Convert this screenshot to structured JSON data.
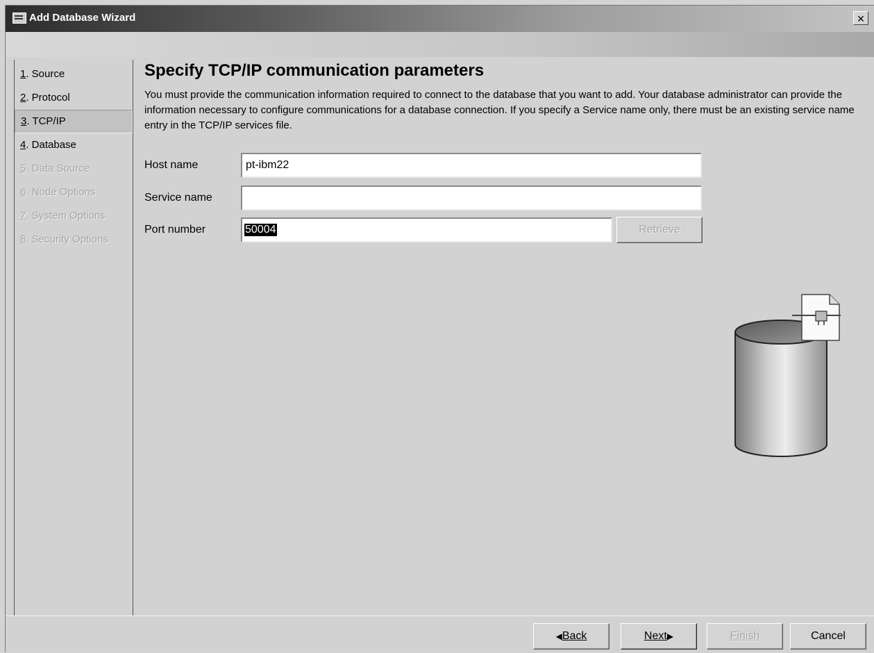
{
  "window": {
    "title": "Add Database Wizard",
    "close_glyph": "✕"
  },
  "sidebar": {
    "items": [
      {
        "num": "1",
        "text": ". Source",
        "state": "enabled"
      },
      {
        "num": "2",
        "text": ". Protocol",
        "state": "enabled"
      },
      {
        "num": "3",
        "text": ". TCP/IP",
        "state": "active"
      },
      {
        "num": "4",
        "text": ". Database",
        "state": "enabled"
      },
      {
        "num": "5",
        "text": ". Data Source",
        "state": "disabled"
      },
      {
        "num": "6",
        "text": ". Node Options",
        "state": "disabled"
      },
      {
        "num": "7",
        "text": ". System Options",
        "state": "disabled"
      },
      {
        "num": "8",
        "text": ". Security Options",
        "state": "disabled"
      }
    ]
  },
  "main": {
    "heading": "Specify TCP/IP communication parameters",
    "description": "You must provide the communication information required to connect to the database that you want to add. Your database administrator can provide the information necessary to configure communications for a database connection. If you specify a Service name only, there must be an existing service name entry in the TCP/IP services file.",
    "host_label": "Host name",
    "host_value": "pt-ibm22",
    "service_label": "Service name",
    "service_value": "",
    "port_label": "Port number",
    "port_value": "50004",
    "retrieve_label": "Retrieve"
  },
  "footer": {
    "back_label": "Back",
    "next_label": "Next",
    "finish_label": "Finish",
    "cancel_label": "Cancel"
  },
  "icons": {
    "database": "database-plug-icon",
    "back_arrow": "◀",
    "next_arrow": "▶"
  }
}
